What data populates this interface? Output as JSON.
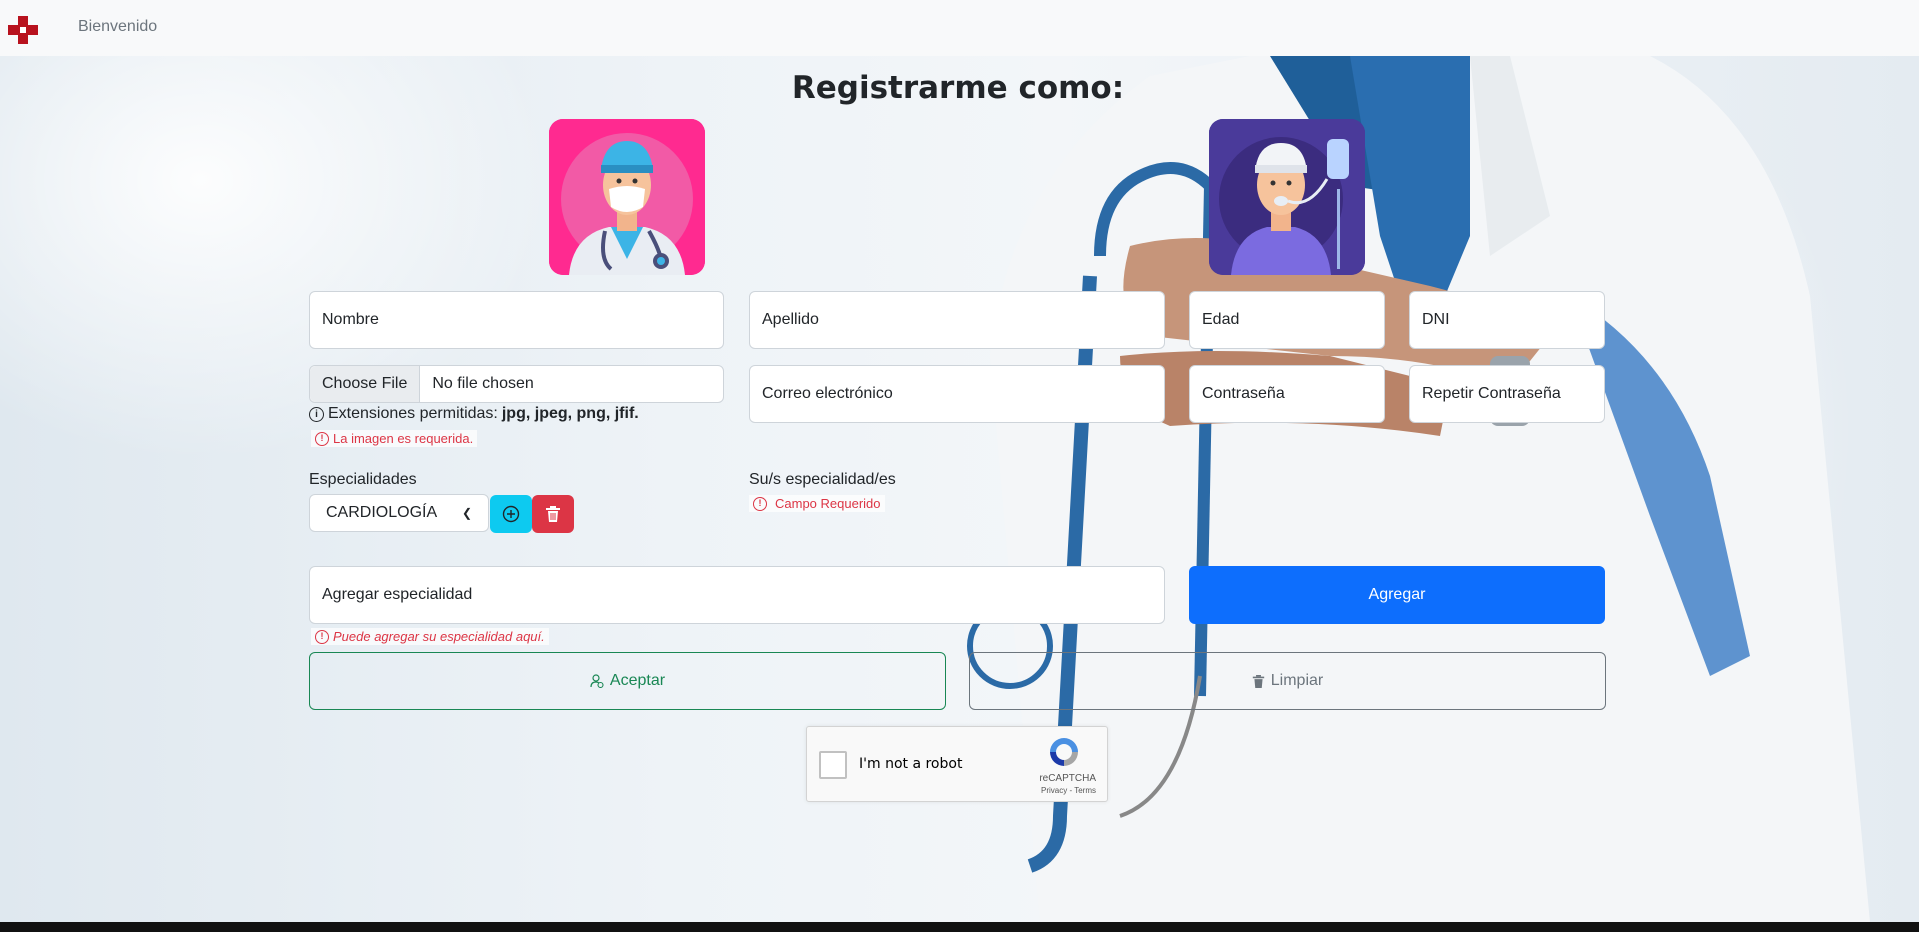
{
  "nav": {
    "link_label": "Bienvenido"
  },
  "heading": "Registrarme como:",
  "avatars": {
    "doctor": "doctor-avatar",
    "patient": "patient-avatar"
  },
  "fields": {
    "nombre": "Nombre",
    "apellido": "Apellido",
    "edad": "Edad",
    "dni": "DNI",
    "correo": "Correo electrónico",
    "password": "Contraseña",
    "repeat_password": "Repetir Contraseña",
    "add_specialty": "Agregar especialidad"
  },
  "file": {
    "button": "Choose File",
    "status": "No file chosen"
  },
  "hint": {
    "prefix": "Extensiones permitidas:",
    "extensions": "jpg, jpeg, png, jfif."
  },
  "errors": {
    "image": "La imagen es requerida.",
    "required": "Campo Requerido",
    "specialty_hint": "Puede agregar su especialidad aquí."
  },
  "specialties": {
    "label": "Especialidades",
    "selected": "CARDIOLOGÍA"
  },
  "your_specialties_label": "Su/s especialidad/es",
  "buttons": {
    "agregar": "Agregar",
    "aceptar": "Aceptar",
    "limpiar": "Limpiar"
  },
  "captcha": {
    "label": "I'm not a robot",
    "brand": "reCAPTCHA",
    "terms": "Privacy - Terms"
  },
  "colors": {
    "primary": "#0d6efd",
    "info": "#0dcaf0",
    "danger": "#dc3545",
    "success": "#198754",
    "secondary": "#6c757d"
  }
}
